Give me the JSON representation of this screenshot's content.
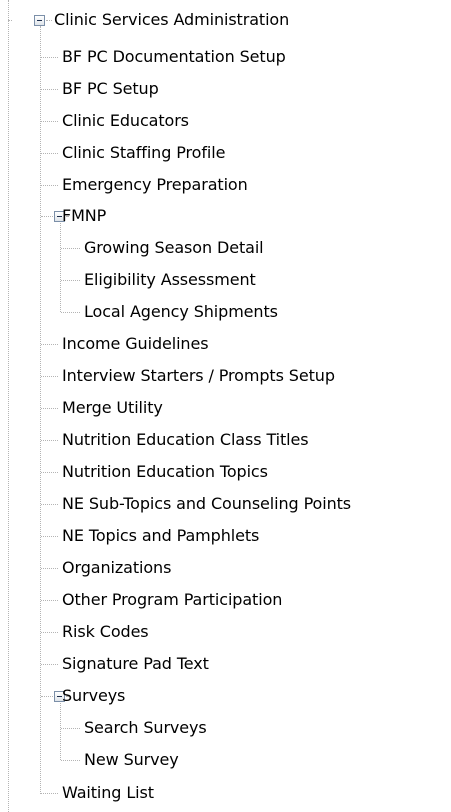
{
  "tree": {
    "root": {
      "label": "Clinic Services Administration",
      "toggle_icon": "minus-box-icon"
    },
    "items": [
      {
        "label": "BF PC Documentation Setup"
      },
      {
        "label": "BF PC Setup"
      },
      {
        "label": "Clinic Educators"
      },
      {
        "label": "Clinic Staffing Profile"
      },
      {
        "label": "Emergency Preparation"
      },
      {
        "label": "FMNP",
        "expanded": true,
        "children": [
          {
            "label": "Growing Season Detail"
          },
          {
            "label": "Eligibility Assessment"
          },
          {
            "label": "Local Agency Shipments"
          }
        ]
      },
      {
        "label": "Income Guidelines"
      },
      {
        "label": "Interview Starters / Prompts Setup"
      },
      {
        "label": "Merge Utility"
      },
      {
        "label": "Nutrition Education Class Titles"
      },
      {
        "label": "Nutrition Education Topics"
      },
      {
        "label": "NE Sub-Topics and Counseling Points"
      },
      {
        "label": "NE Topics and Pamphlets"
      },
      {
        "label": "Organizations"
      },
      {
        "label": "Other Program Participation"
      },
      {
        "label": "Risk Codes"
      },
      {
        "label": "Signature Pad Text"
      },
      {
        "label": "Surveys",
        "expanded": true,
        "children": [
          {
            "label": "Search Surveys"
          },
          {
            "label": "New Survey"
          }
        ]
      },
      {
        "label": "Waiting List"
      }
    ]
  },
  "colors": {
    "connector": "#b4b4b4",
    "toggle_border": "#7b8fa8"
  }
}
